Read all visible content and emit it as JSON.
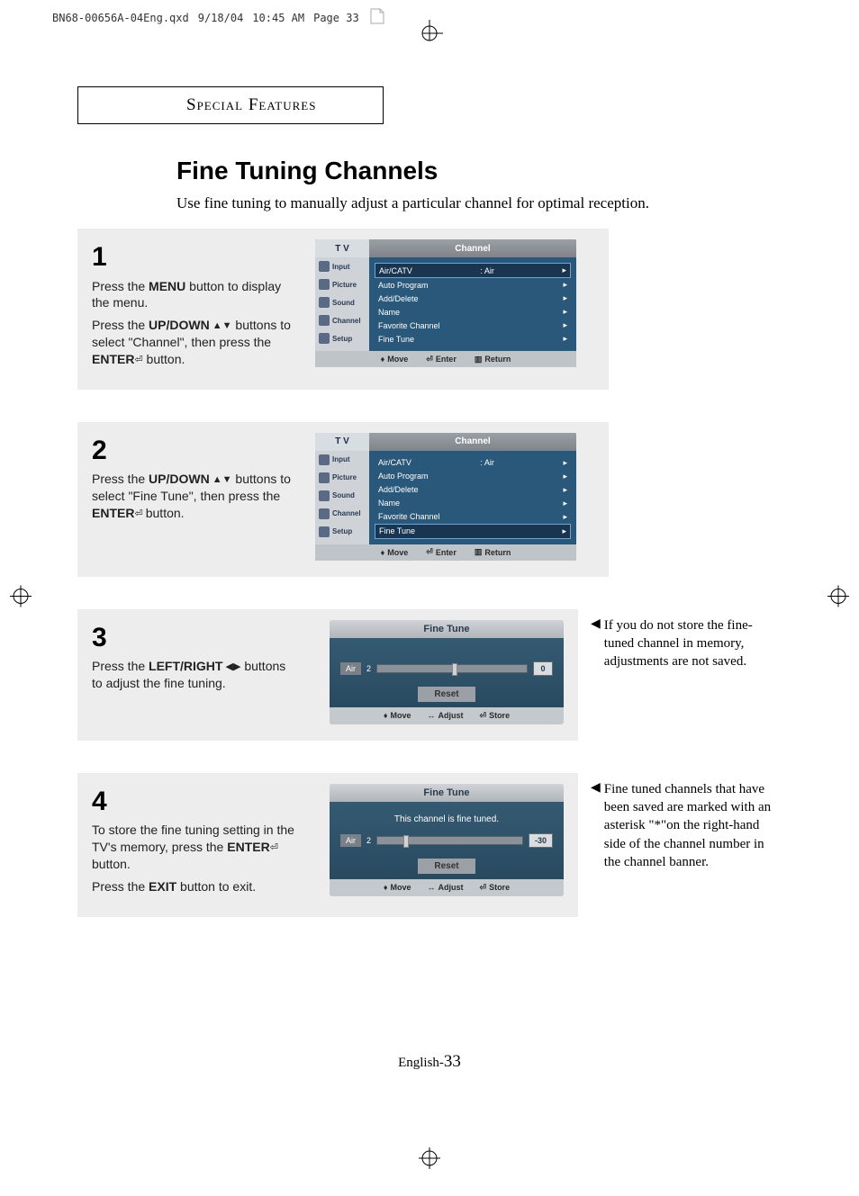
{
  "print": {
    "filename": "BN68-00656A-04Eng.qxd",
    "date": "9/18/04",
    "time": "10:45 AM",
    "pageLabel": "Page 33"
  },
  "section": "Special Features",
  "title": "Fine Tuning Channels",
  "intro": "Use fine tuning to manually adjust a particular channel for optimal reception.",
  "steps": {
    "s1": {
      "num": "1",
      "p1a": "Press the ",
      "p1b": "MENU",
      "p1c": " button to display the menu.",
      "p2a": "Press the ",
      "p2b": "UP/DOWN",
      "p2c": " buttons to select \"Channel\", then press the ",
      "p2d": "ENTER",
      "p2e": " button."
    },
    "s2": {
      "num": "2",
      "p1a": "Press the ",
      "p1b": "UP/DOWN",
      "p1c": " buttons to select \"Fine Tune\", then press the ",
      "p1d": "ENTER",
      "p1e": " button."
    },
    "s3": {
      "num": "3",
      "p1a": "Press the ",
      "p1b": "LEFT/RIGHT",
      "p1c": " buttons to adjust the fine tuning."
    },
    "s4": {
      "num": "4",
      "p1a": "To store the fine tuning setting in the TV's memory, press the ",
      "p1b": "ENTER",
      "p1c": " button.",
      "p2a": "Press the ",
      "p2b": "EXIT",
      "p2c": " button to exit."
    }
  },
  "notes": {
    "n3": "If you do not store the fine-tuned channel in memory, adjustments are not saved.",
    "n4": "Fine tuned channels that have been saved are marked with an asterisk \"*\"on the right-hand side of the channel number in the channel banner."
  },
  "osd": {
    "tv": "T V",
    "title": "Channel",
    "sidebar": [
      "Input",
      "Picture",
      "Sound",
      "Channel",
      "Setup"
    ],
    "menu": {
      "airCatv": "Air/CATV",
      "airCatvVal": ":   Air",
      "autoProgram": "Auto Program",
      "addDelete": "Add/Delete",
      "name": "Name",
      "favorite": "Favorite  Channel",
      "fineTune": "Fine Tune"
    },
    "footer": {
      "move": "Move",
      "enter": "Enter",
      "return": "Return"
    }
  },
  "fineTune": {
    "title": "Fine Tune",
    "msg": "This channel is fine tuned.",
    "air": "Air",
    "channel": "2",
    "val0": "0",
    "valNeg30": "-30",
    "reset": "Reset",
    "footer": {
      "move": "Move",
      "adjust": "Adjust",
      "store": "Store"
    }
  },
  "footer": {
    "lang": "English-",
    "page": "33"
  }
}
